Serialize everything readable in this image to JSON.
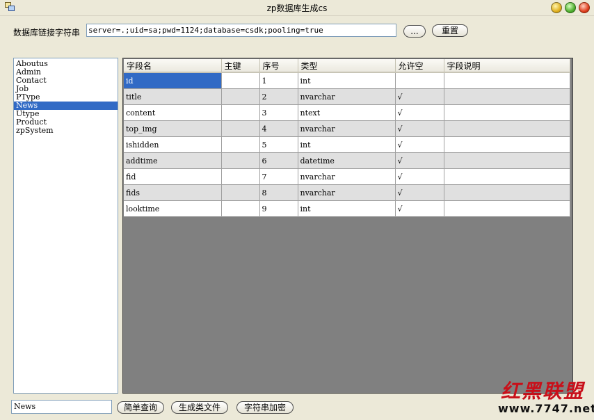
{
  "window": {
    "title": "zp数据库生成cs"
  },
  "connection": {
    "label": "数据库链接字符串",
    "value": "server=.;uid=sa;pwd=1124;database=csdk;pooling=true",
    "browse_label": "...",
    "reset_label": "重置"
  },
  "tables_list": {
    "items": [
      "Aboutus",
      "Admin",
      "Contact",
      "Job",
      "PType",
      "News",
      "Utype",
      "Product",
      "zpSystem"
    ],
    "selected": "News"
  },
  "grid": {
    "columns": [
      "字段名",
      "主键",
      "序号",
      "类型",
      "允许空",
      "字段说明"
    ],
    "rows": [
      {
        "name": "id",
        "pk": "",
        "seq": "1",
        "type": "int",
        "nullable": "",
        "desc": ""
      },
      {
        "name": "title",
        "pk": "",
        "seq": "2",
        "type": "nvarchar",
        "nullable": "√",
        "desc": ""
      },
      {
        "name": "content",
        "pk": "",
        "seq": "3",
        "type": "ntext",
        "nullable": "√",
        "desc": ""
      },
      {
        "name": "top_img",
        "pk": "",
        "seq": "4",
        "type": "nvarchar",
        "nullable": "√",
        "desc": ""
      },
      {
        "name": "ishidden",
        "pk": "",
        "seq": "5",
        "type": "int",
        "nullable": "√",
        "desc": ""
      },
      {
        "name": "addtime",
        "pk": "",
        "seq": "6",
        "type": "datetime",
        "nullable": "√",
        "desc": ""
      },
      {
        "name": "fid",
        "pk": "",
        "seq": "7",
        "type": "nvarchar",
        "nullable": "√",
        "desc": ""
      },
      {
        "name": "fids",
        "pk": "",
        "seq": "8",
        "type": "nvarchar",
        "nullable": "√",
        "desc": ""
      },
      {
        "name": "looktime",
        "pk": "",
        "seq": "9",
        "type": "int",
        "nullable": "√",
        "desc": ""
      }
    ]
  },
  "bottom": {
    "table_name_value": "News",
    "query_label": "简单查询",
    "generate_label": "生成类文件",
    "encrypt_label": "字符串加密"
  },
  "watermark": {
    "text": "红黑联盟",
    "url": "www.7747.net"
  },
  "colors": {
    "selection": "#316ac5",
    "grid_background": "#808080",
    "window_face": "#ece9d8"
  }
}
